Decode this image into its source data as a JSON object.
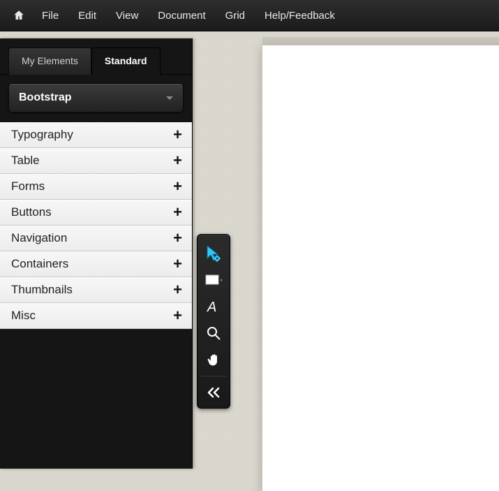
{
  "menubar": {
    "items": [
      "File",
      "Edit",
      "View",
      "Document",
      "Grid",
      "Help/Feedback"
    ]
  },
  "sidebar": {
    "tabs": [
      {
        "label": "My Elements",
        "active": false
      },
      {
        "label": "Standard",
        "active": true
      }
    ],
    "framework_selected": "Bootstrap",
    "categories": [
      "Typography",
      "Table",
      "Forms",
      "Buttons",
      "Navigation",
      "Containers",
      "Thumbnails",
      "Misc"
    ]
  },
  "tools": {
    "items": [
      {
        "id": "move-tool",
        "active": true
      },
      {
        "id": "rectangle-tool",
        "active": false
      },
      {
        "id": "text-tool",
        "active": false
      },
      {
        "id": "zoom-tool",
        "active": false
      },
      {
        "id": "hand-tool",
        "active": false
      }
    ],
    "collapse": "collapse-left"
  }
}
